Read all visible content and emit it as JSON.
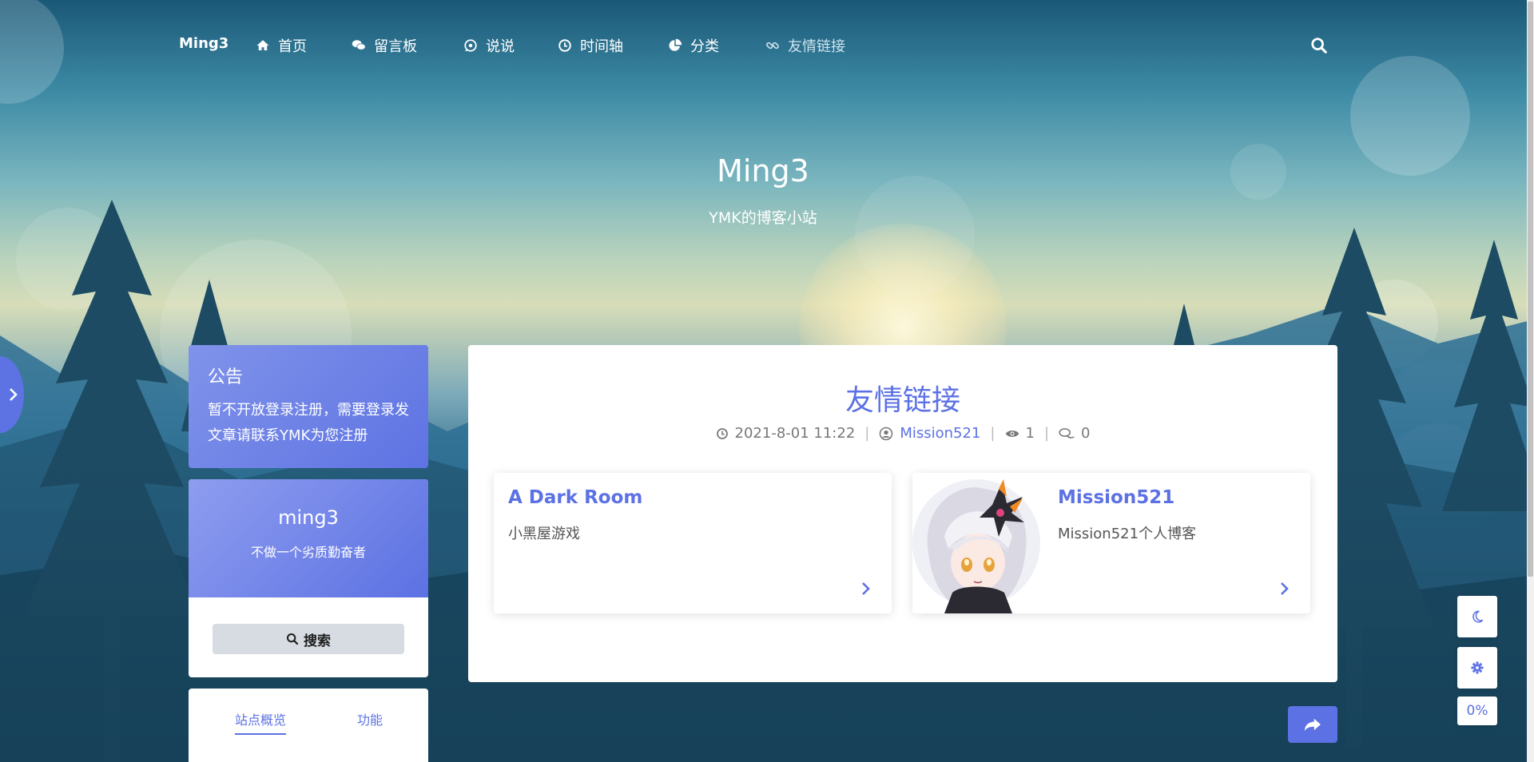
{
  "nav": {
    "brand": "Ming3",
    "items": [
      {
        "label": "首页",
        "icon": "home-icon"
      },
      {
        "label": "留言板",
        "icon": "comments-icon"
      },
      {
        "label": "说说",
        "icon": "whatsapp-icon"
      },
      {
        "label": "时间轴",
        "icon": "clock-icon"
      },
      {
        "label": "分类",
        "icon": "pie-chart-icon"
      },
      {
        "label": "友情链接",
        "icon": "link-icon"
      }
    ],
    "search_icon": "search-icon"
  },
  "hero": {
    "title": "Ming3",
    "subtitle": "YMK的博客小站"
  },
  "sidebar": {
    "notice": {
      "title": "公告",
      "text": "暂不开放登录注册，需要登录发文章请联系YMK为您注册"
    },
    "profile": {
      "name": "ming3",
      "motto": "不做一个劣质勤奋者",
      "search_label": "搜索"
    },
    "overview": {
      "tabs": [
        "站点概览",
        "功能"
      ]
    }
  },
  "post": {
    "title": "友情链接",
    "date": "2021-8-01 11:22",
    "author": "Mission521",
    "views": "1",
    "comments": "0"
  },
  "links": [
    {
      "name": "A Dark Room",
      "desc": "小黑屋游戏"
    },
    {
      "name": "Mission521",
      "desc": "Mission521个人博客"
    }
  ],
  "controls": {
    "progress": "0%"
  },
  "colors": {
    "accent": "#5c71e3",
    "notice_gradient_start": "#8093ea",
    "notice_gradient_end": "#5e73e3"
  }
}
